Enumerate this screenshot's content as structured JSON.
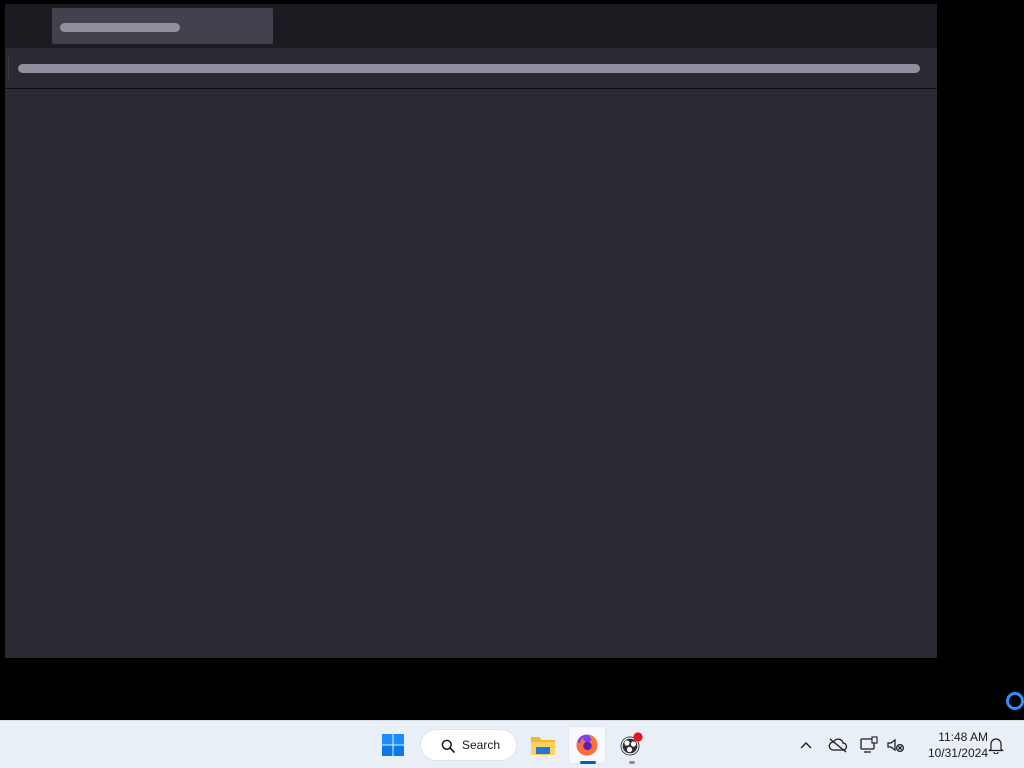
{
  "browser": {
    "name": "Firefox",
    "tab_state": "loading",
    "url_state": "loading"
  },
  "taskbar": {
    "start": {
      "icon": "windows-start-icon"
    },
    "search": {
      "label": "Search",
      "icon": "search-icon"
    },
    "pinned_apps": [
      {
        "name": "File Explorer",
        "icon": "folder-icon",
        "state": "idle"
      },
      {
        "name": "Firefox",
        "icon": "firefox-icon",
        "state": "active"
      },
      {
        "name": "OBS Studio",
        "icon": "obs-icon",
        "state": "running",
        "badge": "recording"
      }
    ],
    "tray": {
      "overflow_icon": "chevron-up-icon",
      "icons": [
        "cloud-offline-icon",
        "network-icon",
        "volume-muted-icon"
      ],
      "time": "11:48 AM",
      "date": "10/31/2024",
      "notification_icon": "bell-icon"
    }
  },
  "colors": {
    "desktop_bg": "#000000",
    "browser_chrome": "#1c1b22",
    "browser_content": "#2b2a33",
    "skeleton": "#8f8f9d",
    "taskbar_bg": "#e9eff7",
    "accent": "#005fb8",
    "spinner": "#2f8ffa",
    "obs_badge": "#e81123"
  }
}
